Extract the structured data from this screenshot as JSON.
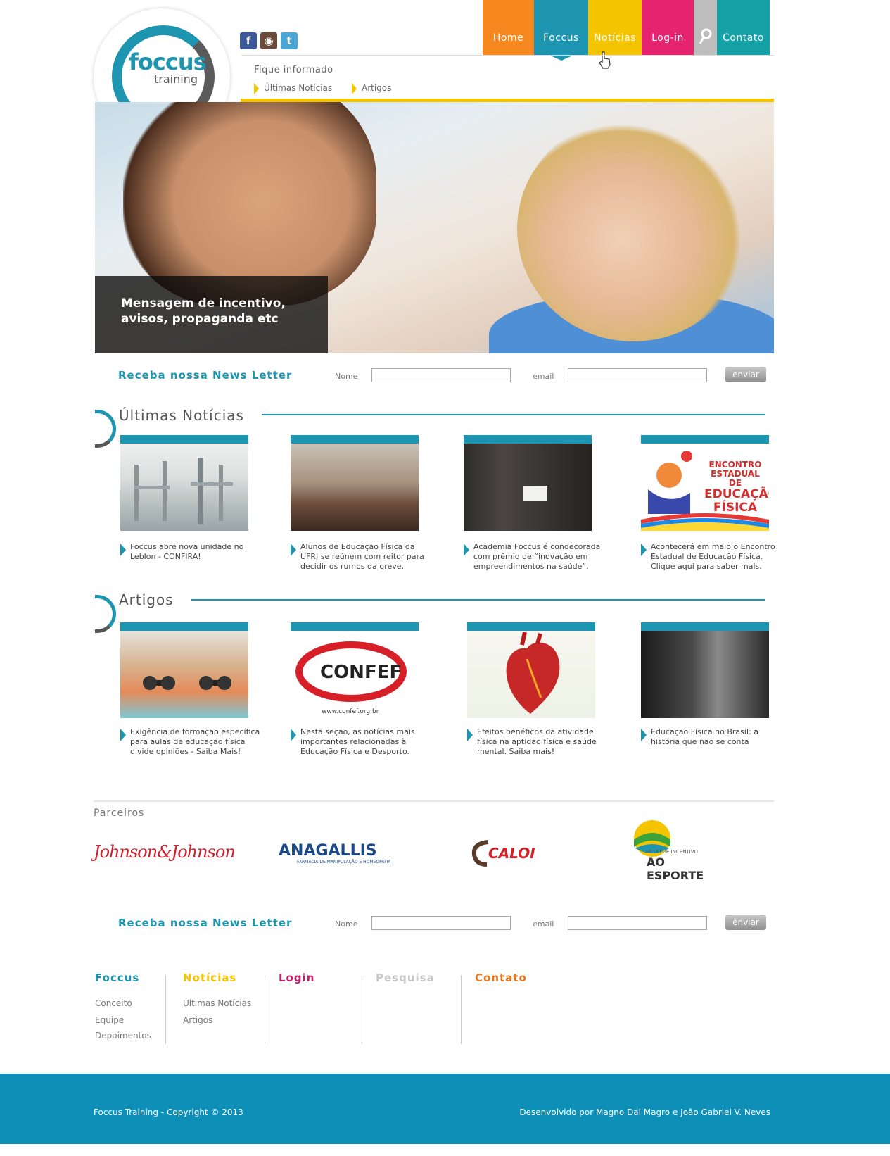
{
  "brand": {
    "logo_main": "foccus",
    "logo_sub": "training"
  },
  "social": [
    {
      "icon": "facebook-icon",
      "glyph": "f",
      "color": "#3b5998"
    },
    {
      "icon": "instagram-icon",
      "glyph": "◉",
      "color": "#6b4a3a"
    },
    {
      "icon": "twitter-icon",
      "glyph": "t",
      "color": "#4aa6d6"
    }
  ],
  "nav": {
    "items": [
      {
        "label": "Home",
        "color": "#f7881f"
      },
      {
        "label": "Foccus",
        "color": "#1e95b0"
      },
      {
        "label": "Notícias",
        "color": "#f5c400"
      },
      {
        "label": "Log-in",
        "color": "#e6236f"
      },
      {
        "label": "",
        "icon": "search-icon",
        "color": "#bdbdbd"
      },
      {
        "label": "Contato",
        "color": "#16a1a6"
      }
    ],
    "submenu_title": "Fique informado",
    "submenu_links": [
      "Últimas Notícias",
      "Artigos"
    ]
  },
  "hero": {
    "caption": "Mensagem de incentivo, avisos, propaganda etc"
  },
  "newsletter": {
    "title": "Receba nossa News Letter",
    "name_label": "Nome",
    "email_label": "email",
    "button": "enviar"
  },
  "news": {
    "title": "Últimas Notícias",
    "items": [
      {
        "text": "Foccus abre nova unidade no Leblon - CONFIRA!"
      },
      {
        "text": "Alunos de Educação Física da UFRJ se reúnem com reitor para decidir os rumos da greve."
      },
      {
        "text": "Academia Foccus é condecorada com prêmio de “inovação em empreendimentos na saúde”."
      },
      {
        "text": "Acontecerá em maio o Encontro Estadual de Educação Física. Clique aqui para saber mais."
      }
    ],
    "poster_text": [
      "ENCONTRO",
      "ESTADUAL DE",
      "EDUCAÇÃO",
      "FÍSICA"
    ]
  },
  "articles": {
    "title": "Artigos",
    "items": [
      {
        "text": "Exigência de formação específica para aulas de educação física divide opiniões - Saiba Mais!"
      },
      {
        "text": "Nesta seção, as notícias mais importantes relacionadas à Educação Física e Desporto."
      },
      {
        "text": "Efeitos benéficos da atividade física na aptidão física e saúde mental. Saiba mais!"
      },
      {
        "text": "Educação Física no Brasil: a história que não se conta"
      }
    ],
    "confef_logo": "CONFEF",
    "confef_url": "www.confef.org.br"
  },
  "partners": {
    "title": "Parceiros",
    "logos": [
      {
        "name": "Johnson&Johnson"
      },
      {
        "name": "ANAGALLIS",
        "tagline": "FARMÁCIA DE MANIPULAÇÃO E HOMEOPATIA"
      },
      {
        "name": "CALOI"
      },
      {
        "name": "AO ESPORTE",
        "tagline": "AR LEI DE INCENTIVO"
      }
    ]
  },
  "footer_nav": {
    "columns": [
      {
        "title": "Foccus",
        "color": "#1e95b0",
        "links": [
          "Conceito",
          "Equipe",
          "Depoimentos"
        ]
      },
      {
        "title": "Notícias",
        "color": "#f5c400",
        "links": [
          "Últimas Notícias",
          "Artigos"
        ]
      },
      {
        "title": "Login",
        "color": "#c21f6b",
        "links": []
      },
      {
        "title": "Pesquisa",
        "color": "#c8c8c8",
        "links": []
      },
      {
        "title": "Contato",
        "color": "#e8771e",
        "links": []
      }
    ]
  },
  "footer": {
    "copyright": "Foccus Training - Copyright © 2013",
    "credits": "Desenvolvido por Magno Dal Magro e João Gabriel V. Neves"
  }
}
